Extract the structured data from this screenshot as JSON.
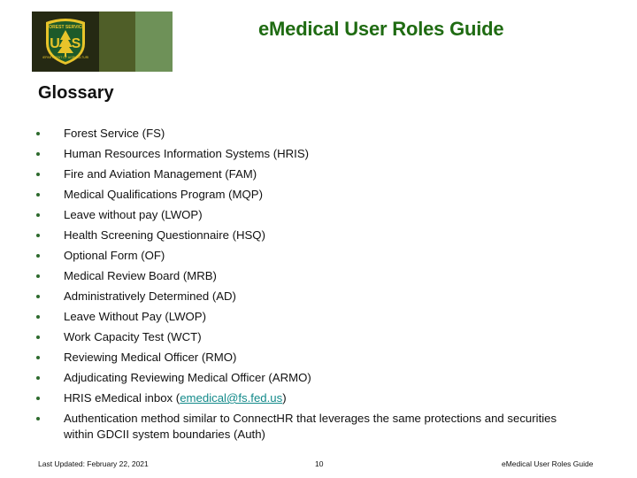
{
  "header": {
    "logo": {
      "icon": "forest-service-shield-icon",
      "text_top": "FOREST SERVICE",
      "letters": "U S",
      "text_bottom": "DEPARTMENT OF AGRICULTURE"
    },
    "banner_colors": [
      "#252913",
      "#4f5e28",
      "#6e9158"
    ],
    "title": "eMedical User Roles Guide",
    "title_color": "#1f6b12"
  },
  "page": {
    "heading": "Glossary",
    "bullet_color": "#2d6a2d",
    "link_color": "#138a8a",
    "items": [
      {
        "text": "Forest Service (FS)"
      },
      {
        "text": "Human Resources Information Systems (HRIS)"
      },
      {
        "text": "Fire and Aviation Management (FAM)"
      },
      {
        "text": "Medical Qualifications Program (MQP)"
      },
      {
        "text": "Leave without pay (LWOP)"
      },
      {
        "text": "Health Screening Questionnaire (HSQ)"
      },
      {
        "text": "Optional Form (OF)"
      },
      {
        "text": "Medical Review Board (MRB)"
      },
      {
        "text": "Administratively Determined (AD)"
      },
      {
        "text": "Leave Without Pay (LWOP)"
      },
      {
        "text": "Work Capacity Test (WCT)"
      },
      {
        "text": "Reviewing Medical Officer (RMO)"
      },
      {
        "text": "Adjudicating Reviewing Medical Officer (ARMO)"
      },
      {
        "prefix": "HRIS eMedical inbox (",
        "link": "emedical@fs.fed.us",
        "suffix": ")"
      },
      {
        "text": "Authentication method similar to ConnectHR that leverages the same protections and securities within GDCII system boundaries (Auth)"
      }
    ]
  },
  "footer": {
    "last_updated": "Last Updated: February 22, 2021",
    "page_number": "10",
    "doc_title": "eMedical User Roles Guide"
  }
}
